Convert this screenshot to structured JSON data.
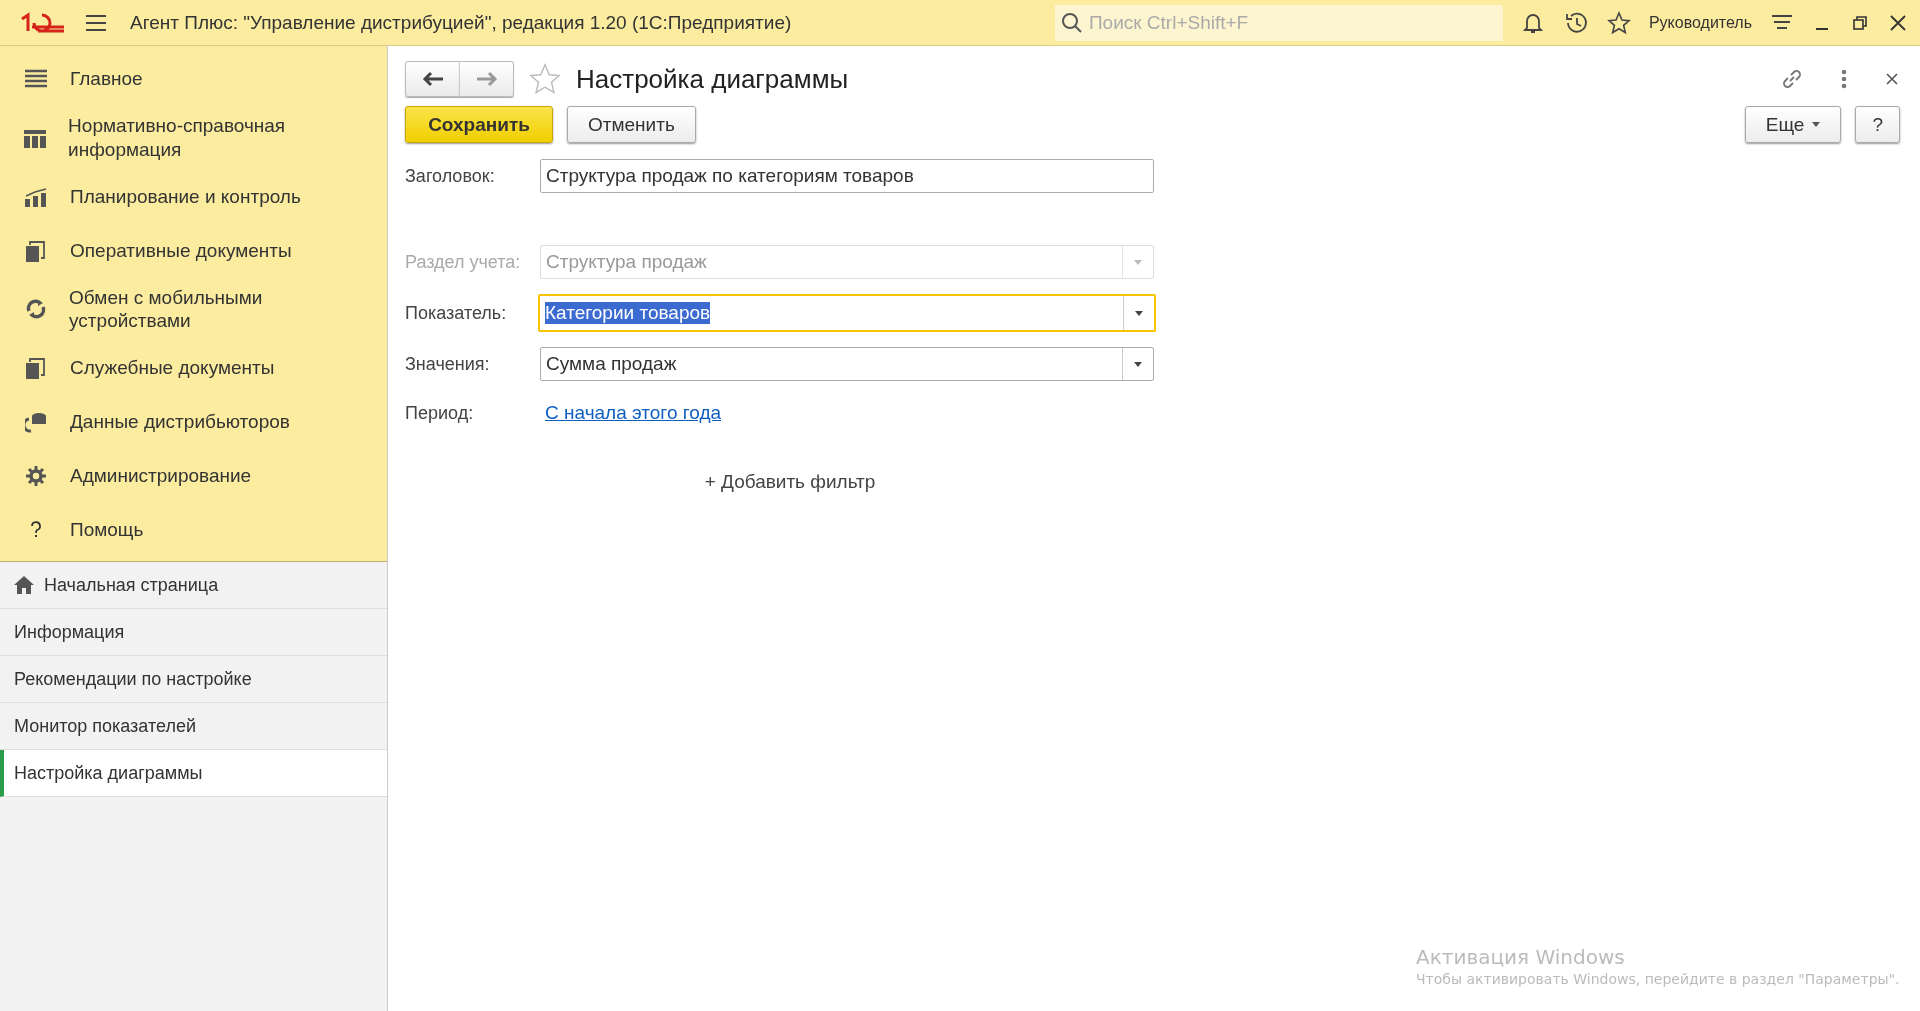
{
  "window": {
    "title": "Агент Плюс: \"Управление дистрибуцией\", редакция 1.20  (1С:Предприятие)",
    "search": {
      "placeholder": "Поиск Ctrl+Shift+F"
    },
    "user": "Руководитель"
  },
  "sections": [
    {
      "label": "Главное"
    },
    {
      "label": "Нормативно-справочная информация"
    },
    {
      "label": "Планирование и контроль"
    },
    {
      "label": "Оперативные документы"
    },
    {
      "label": "Обмен с мобильными устройствами"
    },
    {
      "label": "Служебные документы"
    },
    {
      "label": "Данные дистрибьюторов"
    },
    {
      "label": "Администрирование"
    },
    {
      "label": "Помощь"
    }
  ],
  "open_windows": [
    {
      "label": "Начальная страница",
      "home": true,
      "selected": false
    },
    {
      "label": "Информация",
      "home": false,
      "selected": false
    },
    {
      "label": "Рекомендации по настройке",
      "home": false,
      "selected": false
    },
    {
      "label": "Монитор показателей",
      "home": false,
      "selected": false
    },
    {
      "label": "Настройка диаграммы",
      "home": false,
      "selected": true
    }
  ],
  "form": {
    "title": "Настройка диаграммы",
    "save_button": "Сохранить",
    "cancel_button": "Отменить",
    "more_button": "Еще",
    "help_button": "?",
    "fields": [
      {
        "kind": "text",
        "label": "Заголовок:",
        "value": "Структура продаж по категориям товаров",
        "disabled": false,
        "focused": false
      },
      {
        "kind": "select",
        "label": "Раздел учета:",
        "value": "Структура продаж",
        "disabled": true,
        "focused": false
      },
      {
        "kind": "select",
        "label": "Показатель:",
        "value": "Категории товаров",
        "disabled": false,
        "focused": true
      },
      {
        "kind": "select",
        "label": "Значения:",
        "value": "Сумма продаж",
        "disabled": false,
        "focused": false
      },
      {
        "kind": "link",
        "label": "Период:",
        "value": "С начала этого года",
        "disabled": false,
        "focused": false
      }
    ],
    "add_filter": "+ Добавить фильтр"
  },
  "activation_notice": {
    "title": "Активация Windows",
    "text": "Чтобы активировать Windows, перейдите в раздел \"Параметры\"."
  }
}
